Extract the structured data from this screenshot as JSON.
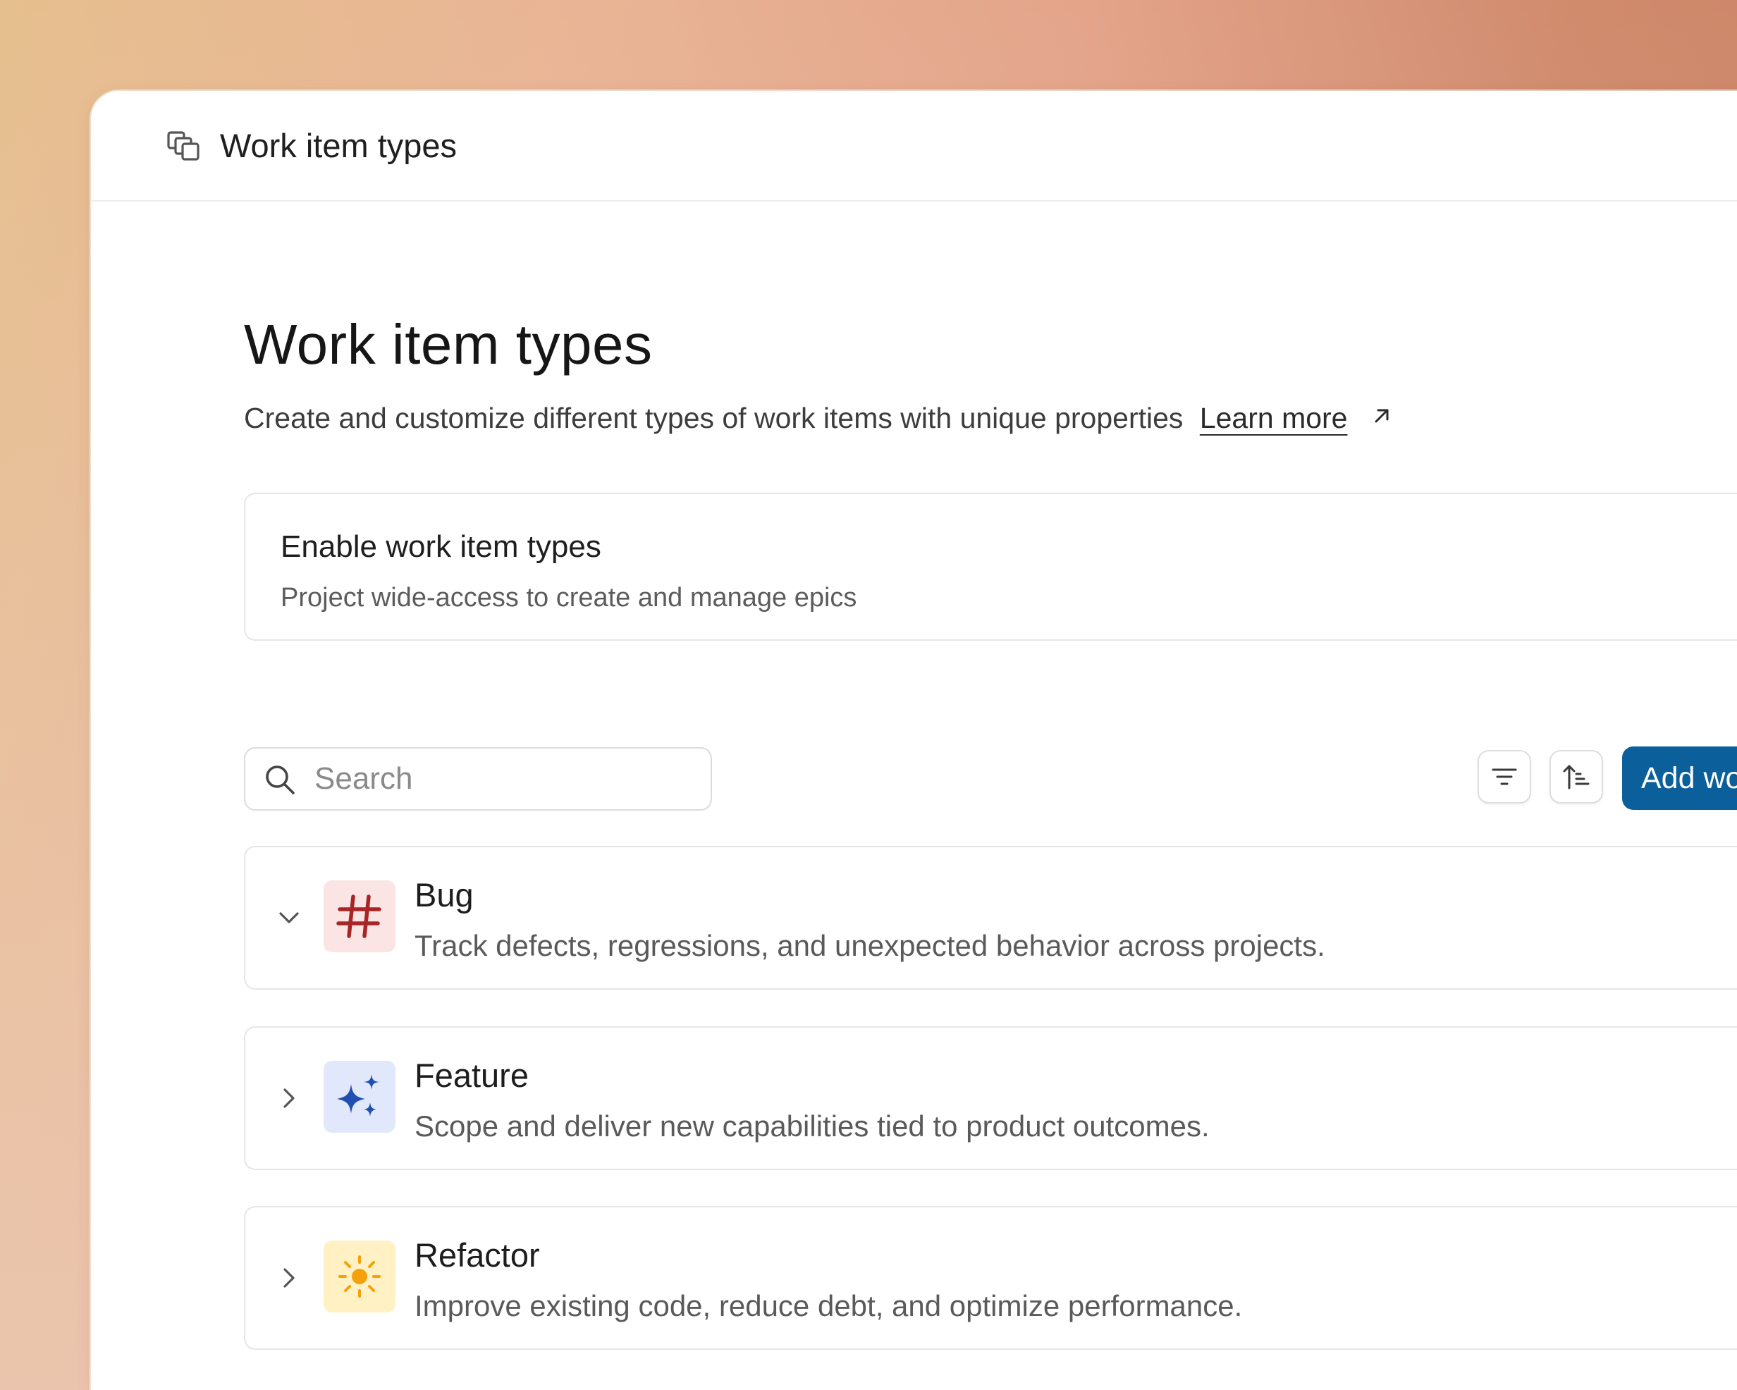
{
  "colors": {
    "accent": "#0b5f9a",
    "bug_icon_bg": "#fbe4e4",
    "bug_icon_fg": "#a82525",
    "feature_icon_bg": "#e1e8fb",
    "feature_icon_fg": "#1f4fb0",
    "refactor_icon_bg": "#fff1c4",
    "refactor_icon_fg": "#f4a10c"
  },
  "topbar": {
    "icon": "work-item-types-icon",
    "title": "Work item types"
  },
  "page": {
    "title": "Work item types",
    "description": "Create and customize different types of work items with unique properties",
    "learn_more": "Learn more"
  },
  "enable": {
    "title": "Enable work item types",
    "subtitle": "Project wide-access to create and manage epics"
  },
  "toolbar": {
    "search_placeholder": "Search",
    "search_value": "",
    "filter_icon": "filter-icon",
    "sort_icon": "sort-icon",
    "add_label": "Add wo"
  },
  "types": [
    {
      "name": "Bug",
      "description": "Track defects, regressions, and unexpected behavior across projects.",
      "icon": "hash-icon",
      "expanded": true
    },
    {
      "name": "Feature",
      "description": "Scope and deliver new capabilities tied to product outcomes.",
      "icon": "sparkles-icon",
      "expanded": false
    },
    {
      "name": "Refactor",
      "description": "Improve existing code, reduce debt, and optimize performance.",
      "icon": "sun-icon",
      "expanded": false
    }
  ]
}
